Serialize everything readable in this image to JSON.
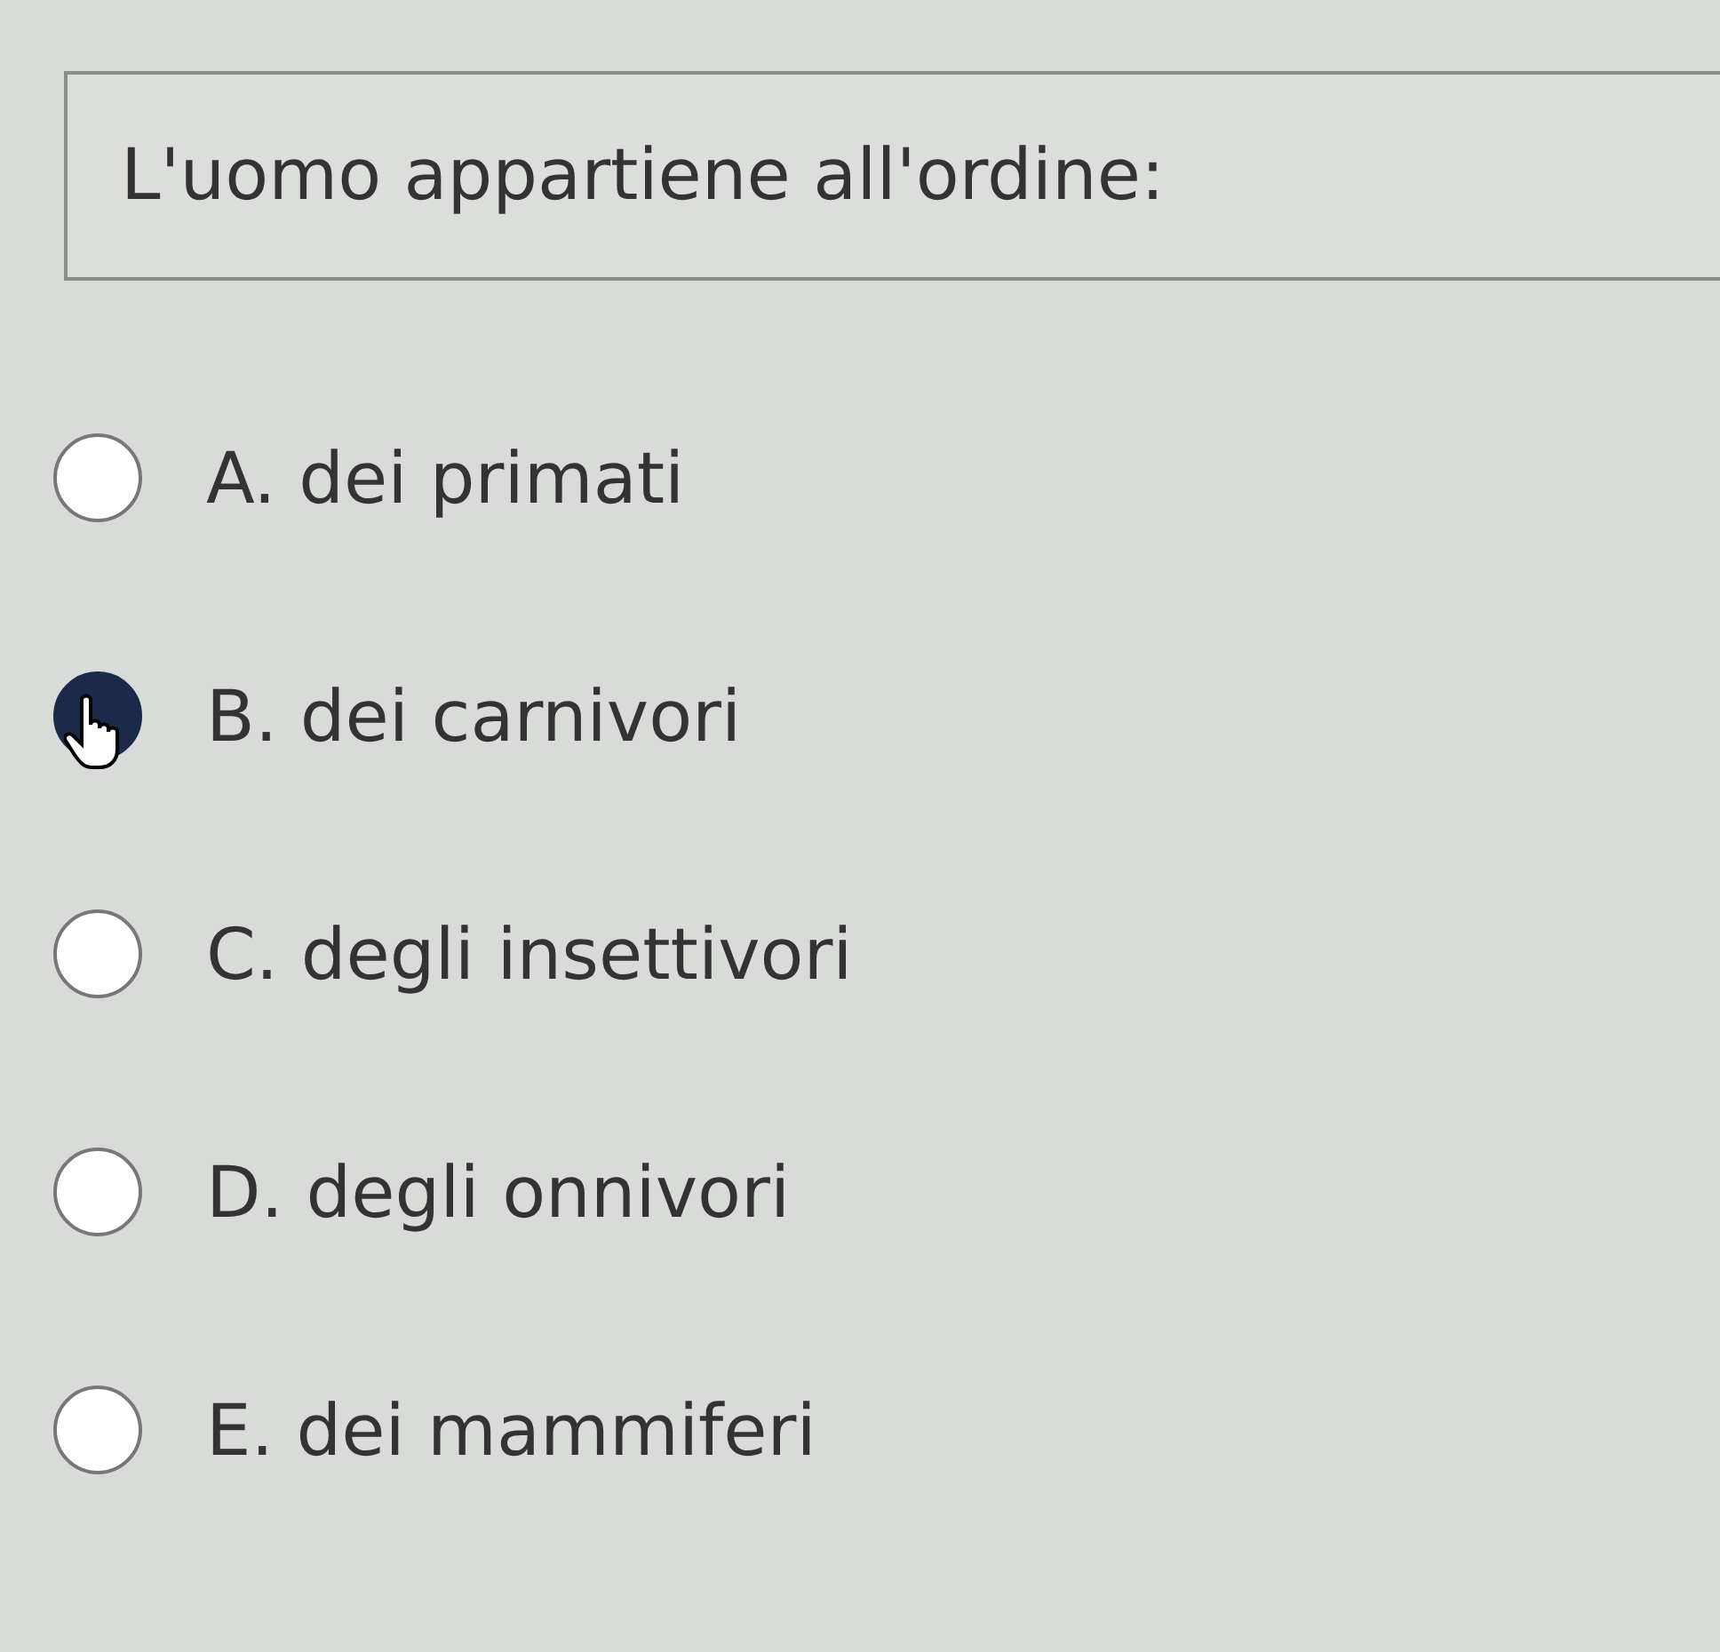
{
  "question": "L'uomo appartiene all'ordine:",
  "options": [
    {
      "label": "A. dei primati",
      "selected": false
    },
    {
      "label": "B. dei carnivori",
      "selected": true
    },
    {
      "label": "C. degli insettivori",
      "selected": false
    },
    {
      "label": "D. degli onnivori",
      "selected": false
    },
    {
      "label": "E. dei mammiferi",
      "selected": false
    }
  ]
}
